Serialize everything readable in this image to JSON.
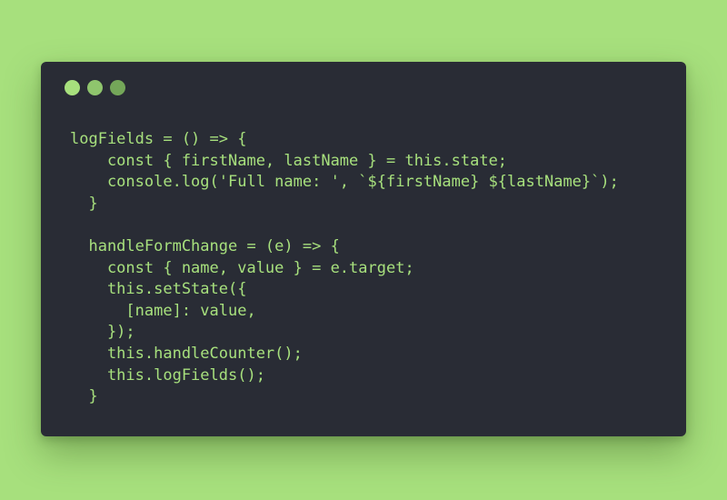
{
  "window": {
    "controls": [
      {
        "name": "close-dot"
      },
      {
        "name": "minimize-dot"
      },
      {
        "name": "maximize-dot"
      }
    ]
  },
  "code": {
    "language": "javascript",
    "lines": [
      "logFields = () => {",
      "    const { firstName, lastName } = this.state;",
      "    console.log('Full name: ', `${firstName} ${lastName}`);",
      "  }",
      "",
      "  handleFormChange = (e) => {",
      "    const { name, value } = e.target;",
      "    this.setState({",
      "      [name]: value,",
      "    });",
      "    this.handleCounter();",
      "    this.logFields();",
      "  }"
    ]
  },
  "colors": {
    "background": "#a7e07d",
    "window": "#292c35",
    "code_text": "#a7e07d",
    "dot_close": "#a7e07d",
    "dot_minimize": "#8fc56d",
    "dot_maximize": "#74a759"
  }
}
